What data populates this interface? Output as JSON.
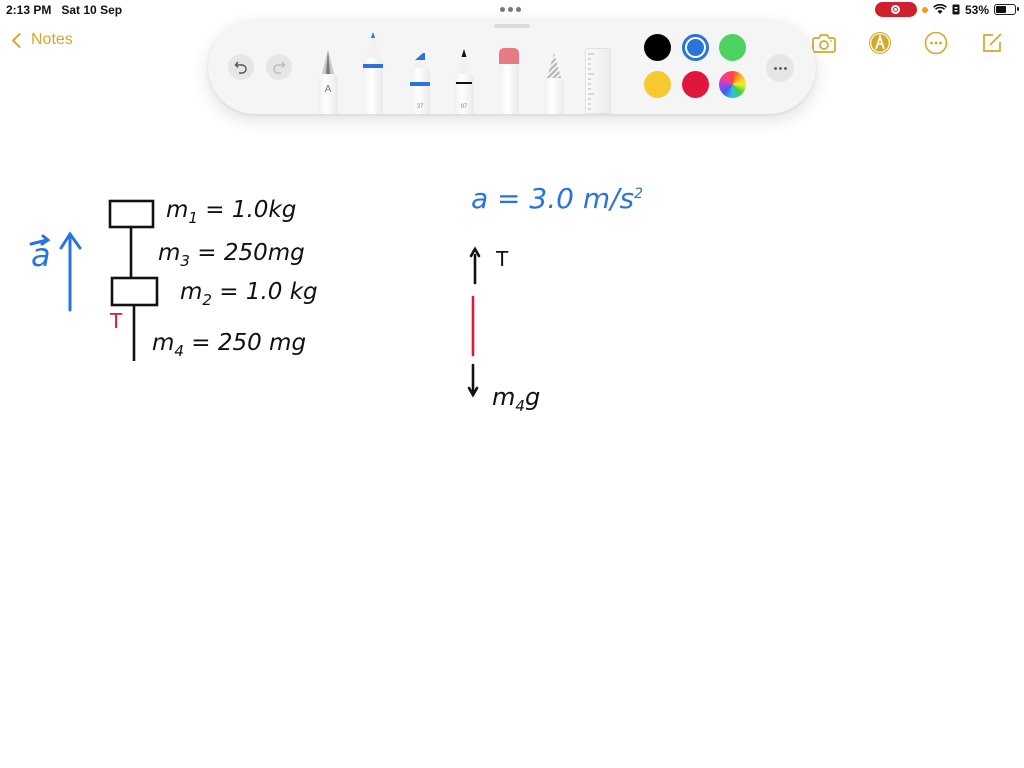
{
  "status_bar": {
    "time": "2:13 PM",
    "date": "Sat 10 Sep",
    "battery_percent": "53%",
    "battery_level": 0.53
  },
  "nav": {
    "back_label": "Notes",
    "icons": [
      "camera-icon",
      "markup-icon",
      "more-icon",
      "compose-icon"
    ]
  },
  "palette": {
    "tools": [
      {
        "name": "pen",
        "label": "A"
      },
      {
        "name": "marker",
        "label": ""
      },
      {
        "name": "highlighter",
        "label": "37"
      },
      {
        "name": "fineliner",
        "label": "97"
      },
      {
        "name": "eraser",
        "label": ""
      },
      {
        "name": "lasso",
        "label": ""
      },
      {
        "name": "ruler",
        "label": ""
      }
    ],
    "colors": [
      {
        "name": "black",
        "hex": "#000000"
      },
      {
        "name": "blue",
        "hex": "#2a74db",
        "selected": true
      },
      {
        "name": "green",
        "hex": "#4cd25e"
      },
      {
        "name": "yellow",
        "hex": "#f7c92f"
      },
      {
        "name": "red",
        "hex": "#e0163c"
      },
      {
        "name": "multicolor",
        "hex": "rainbow"
      }
    ]
  },
  "note": {
    "accel_vector": "a",
    "m1": {
      "sym": "m",
      "sub": "1",
      "eq": "= 1.0kg"
    },
    "m3": {
      "sym": "m",
      "sub": "3",
      "eq": "= 250mg"
    },
    "m2": {
      "sym": "m",
      "sub": "2",
      "eq": "= 1.0 kg"
    },
    "m4": {
      "sym": "m",
      "sub": "4",
      "eq": "= 250 mg"
    },
    "tension_label": "T",
    "accel_eq": "a =  3.0 m/s",
    "accel_exp": "2",
    "fbd_tension": "T",
    "fbd_weight_m": "m",
    "fbd_weight_sub": "4",
    "fbd_weight_g": "g"
  },
  "colors": {
    "accent": "#d4a92b",
    "ink_blue": "#2a74db",
    "ink_red": "#e0163c",
    "ink_black": "#111111"
  }
}
